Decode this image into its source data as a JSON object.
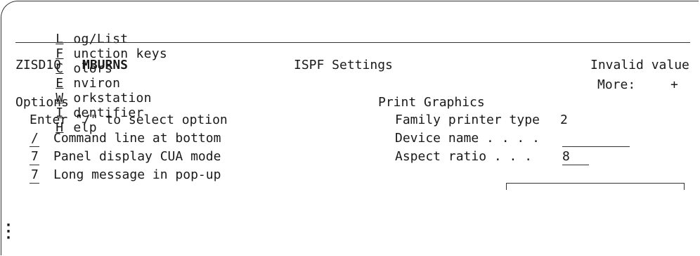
{
  "menubar": {
    "items": [
      {
        "mnemonic": "L",
        "rest": "og/List"
      },
      {
        "mnemonic": "F",
        "rest": "unction keys"
      },
      {
        "mnemonic": "C",
        "rest": "olors"
      },
      {
        "mnemonic": "E",
        "rest": "nviron"
      },
      {
        "mnemonic": "W",
        "rest": "orkstation"
      },
      {
        "mnemonic": "I",
        "rest": "dentifier"
      },
      {
        "mnemonic": "H",
        "rest": "elp"
      }
    ]
  },
  "header": {
    "panel_id": "ZISD10",
    "user_id": "MBURNS",
    "title": "ISPF Settings",
    "message": "Invalid value",
    "more_label": "More:",
    "more_indicator": "+"
  },
  "options": {
    "heading": "Options",
    "instruction": "Enter \"/\" to select option",
    "items": [
      {
        "selection": "/",
        "label": "Command line at bottom"
      },
      {
        "selection": "7",
        "label": "Panel display CUA mode"
      },
      {
        "selection": "7",
        "label": "Long message in pop-up"
      }
    ]
  },
  "print_graphics": {
    "heading": "Print Graphics",
    "family_printer_label": "Family printer type",
    "family_printer_value": "2",
    "device_name_label": "Device name . . . .",
    "device_name_value": "",
    "aspect_ratio_label": "Aspect ratio . . .",
    "aspect_ratio_value": "8"
  },
  "continuation_icon": "vertical-ellipsis"
}
